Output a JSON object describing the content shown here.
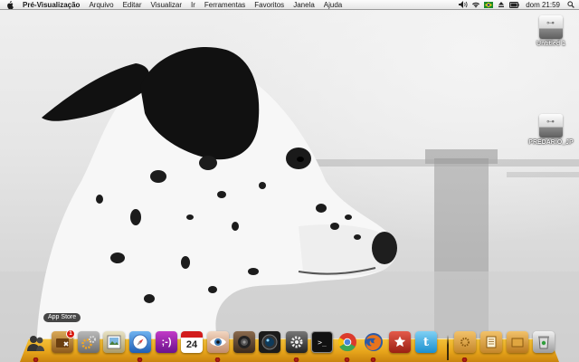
{
  "menubar": {
    "app_name": "Pré-Visualização",
    "items": [
      "Arquivo",
      "Editar",
      "Visualizar",
      "Ir",
      "Ferramentas",
      "Favoritos",
      "Janela",
      "Ajuda"
    ],
    "clock": "dom 21:59"
  },
  "desktop": {
    "drives": [
      {
        "label": "Untitled 1"
      },
      {
        "label": "PREDARIO_JP"
      }
    ]
  },
  "dock": {
    "tooltip": "App Store",
    "badge_count": "1",
    "calendar_day": "24",
    "terminal_glyph": ">_"
  }
}
